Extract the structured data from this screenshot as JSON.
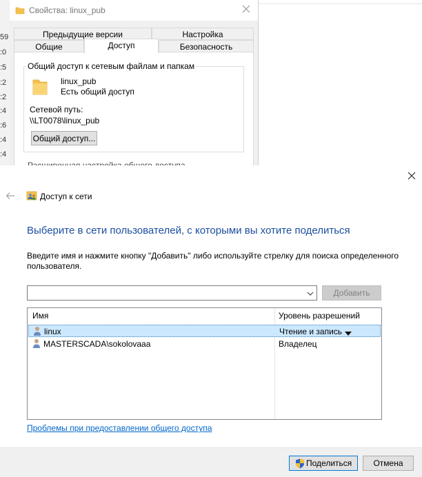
{
  "background": {
    "left_column_times": [
      "59",
      ":0",
      ":5",
      ":2",
      ":2",
      ":4",
      ":6",
      ":4",
      ":4"
    ],
    "properties_window": {
      "title": "Свойства: linux_pub",
      "tabs_back": [
        "Предыдущие версии",
        "Настройка"
      ],
      "tabs_front": [
        "Общие",
        "Доступ",
        "Безопасность"
      ],
      "active_tab": "Доступ",
      "group_title": "Общий доступ к сетевым файлам и папкам",
      "folder_name": "linux_pub",
      "share_status": "Есть общий доступ",
      "network_path_label": "Сетевой путь:",
      "network_path": "\\\\LT0078\\linux_pub",
      "share_button": "Общий доступ...",
      "cut_text": "Расширенная настройка общего доступа"
    }
  },
  "dialog": {
    "title": "Доступ к сети",
    "heading": "Выберите в сети пользователей, с которыми вы хотите поделиться",
    "instruction": "Введите имя и нажмите кнопку \"Добавить\" либо используйте стрелку для поиска определенного пользователя.",
    "combo_value": "",
    "add_button": "Добавить",
    "columns": {
      "name": "Имя",
      "permission": "Уровень разрешений"
    },
    "rows": [
      {
        "name": "linux",
        "permission": "Чтение и запись",
        "selected": true
      },
      {
        "name": "MASTERSCADA\\sokolovaaa",
        "permission": "Владелец",
        "selected": false
      }
    ],
    "help_link": "Проблемы при предоставлении общего доступа",
    "share_button": "Поделиться",
    "cancel_button": "Отмена"
  },
  "colors": {
    "heading": "#1c4fa0",
    "link": "#0066cc",
    "selection": "#cce8ff",
    "primary_border": "#0078d7",
    "folder": "#f4c24c"
  },
  "icons": [
    "folder-icon",
    "close-icon",
    "back-arrow-icon",
    "network-users-icon",
    "user-icon",
    "chevron-down-icon",
    "dropdown-arrow-icon",
    "uac-shield-icon"
  ]
}
